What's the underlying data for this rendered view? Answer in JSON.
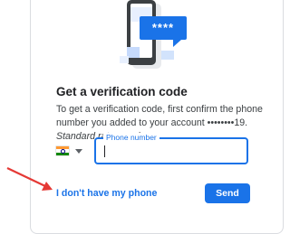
{
  "verification": {
    "heading": "Get a verification code",
    "description": "To get a verification code, first confirm the phone number you added to your account ••••••••19.",
    "rates_note": "Standard rates apply",
    "masked_password": "****"
  },
  "country_selector": {
    "flag": "india-flag-icon"
  },
  "phone_field": {
    "label": "Phone number",
    "value": "",
    "placeholder": ""
  },
  "actions": {
    "no_phone_label": "I don't have my phone",
    "send_label": "Send"
  },
  "colors": {
    "accent": "#1a73e8",
    "annotation_arrow": "#e53935",
    "card_border": "#dadce0"
  }
}
